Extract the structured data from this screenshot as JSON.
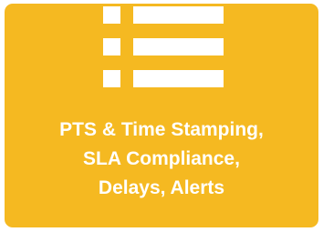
{
  "tile": {
    "icon": "bulleted-list-icon",
    "lines": [
      "PTS & Time Stamping,",
      "SLA Compliance,",
      "Delays, Alerts"
    ]
  },
  "colors": {
    "tile_background": "#F5B921",
    "foreground": "#ffffff"
  }
}
